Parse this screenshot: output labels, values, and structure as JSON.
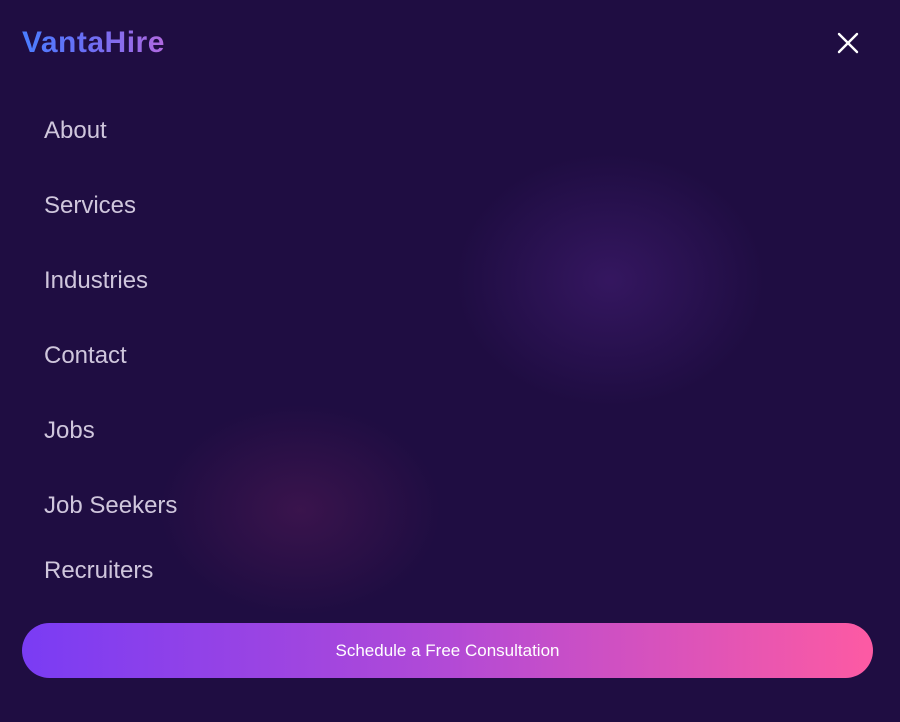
{
  "header": {
    "logo_text": "VantaHire",
    "close_icon": "close-icon"
  },
  "nav": {
    "items": [
      {
        "label": "About"
      },
      {
        "label": "Services"
      },
      {
        "label": "Industries"
      },
      {
        "label": "Contact"
      },
      {
        "label": "Jobs"
      },
      {
        "label": "Job Seekers"
      },
      {
        "label": "Recruiters"
      }
    ]
  },
  "cta": {
    "label": "Schedule a Free Consultation"
  },
  "colors": {
    "background": "#1f0d42",
    "nav_text": "#cfc6dc",
    "logo_gradient_start": "#4a7dff",
    "logo_gradient_end": "#b069e0",
    "cta_gradient_start": "#7a3cf4",
    "cta_gradient_end": "#fd5aa3"
  }
}
